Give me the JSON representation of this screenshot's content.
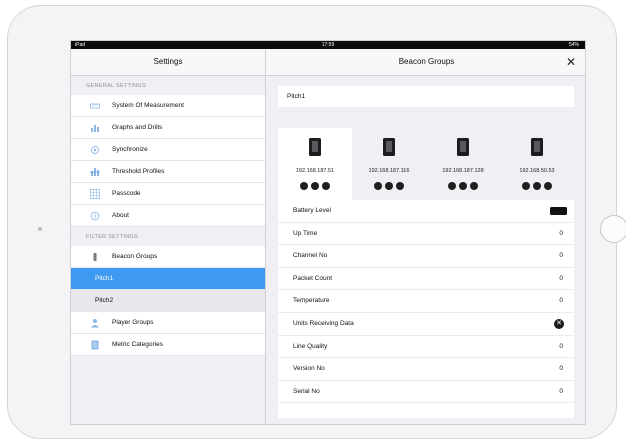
{
  "status_bar": {
    "left": "iPad",
    "time": "17:59",
    "right": "54%"
  },
  "sidebar": {
    "title": "Settings",
    "general_section": "GENERAL SETTINGS",
    "general_items": [
      {
        "label": "System Of Measurement",
        "icon": "ruler-icon"
      },
      {
        "label": "Graphs and Drills",
        "icon": "bar-chart-icon"
      },
      {
        "label": "Synchronize",
        "icon": "sync-icon"
      },
      {
        "label": "Threshold Profiles",
        "icon": "threshold-chart-icon"
      },
      {
        "label": "Passcode",
        "icon": "keypad-icon"
      },
      {
        "label": "About",
        "icon": "info-icon"
      }
    ],
    "filter_section": "FILTER SETTINGS",
    "beacon_groups": {
      "label": "Beacon Groups",
      "icon": "beacon-icon"
    },
    "beacon_group_items": [
      "Pitch1",
      "Pitch2"
    ],
    "selected_group": "Pitch1",
    "player_groups": {
      "label": "Player Groups",
      "icon": "players-icon"
    },
    "metric_categories": {
      "label": "Metric Categories",
      "icon": "list-icon"
    }
  },
  "main": {
    "title": "Beacon Groups",
    "close_label": "✕",
    "group_name": "Pitch1",
    "beacons": [
      {
        "ip": "192.168.187.51"
      },
      {
        "ip": "192.168.187.116"
      },
      {
        "ip": "192.168.187.128"
      },
      {
        "ip": "192.168.50.53"
      }
    ],
    "properties": [
      {
        "label": "Battery Level",
        "value": ""
      },
      {
        "label": "Up Time",
        "value": "0"
      },
      {
        "label": "Channel No",
        "value": "0"
      },
      {
        "label": "Packet Count",
        "value": "0"
      },
      {
        "label": "Temperature",
        "value": "0"
      },
      {
        "label": "Units Receiving Data",
        "value": ""
      },
      {
        "label": "Line Quality",
        "value": "0"
      },
      {
        "label": "Version No",
        "value": "0"
      },
      {
        "label": "Serial No",
        "value": "0"
      }
    ]
  },
  "colors": {
    "accent": "#3d9af0",
    "icon": "#8ab8e6"
  }
}
